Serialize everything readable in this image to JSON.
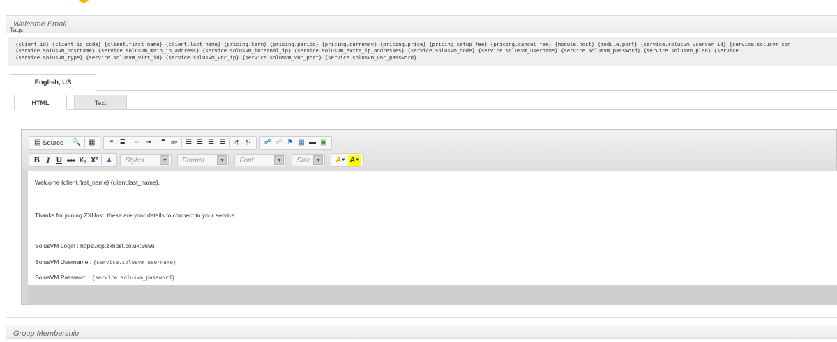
{
  "welcome_email": {
    "header": "Welcome Email",
    "tags_label": "Tags:",
    "tags_lines": [
      "{client.id} {client.id_code} {client.first_name} {client.last_name} {pricing.term} {pricing.period} {pricing.currency} {pricing.price} {pricing.setup_fee} {pricing.cancel_fee} {module.host} {module.port} {service.solusvm_vserver_id} {service.solusvm_con",
      "{service.solusvm_hostname} {service.solusvm_main_ip_address} {service.solusvm_internal_ip} {service.solusvm_extra_ip_addresses} {service.solusvm_node} {service.solusvm_username} {service.solusvm_password} {service.solusvm_plan} {service.",
      "{service.solusvm_type} {service.solusvm_virt_id} {service.solusvm_vnc_ip} {service.solusvm_vnc_port} {service.solusvm_vnc_password}"
    ],
    "language_tab": "English, US",
    "mode_tabs": {
      "html": "HTML",
      "text": "Text"
    }
  },
  "toolbar": {
    "source_label": "Source",
    "bold": "B",
    "italic": "I",
    "underline": "U",
    "strike": "abc",
    "subscript": "X₂",
    "superscript": "X²",
    "styles_placeholder": "Styles",
    "format_placeholder": "Format",
    "font_placeholder": "Font",
    "size_placeholder": "Size",
    "text_color": "A",
    "bg_color": "A",
    "icons": {
      "source": "source-doc-icon",
      "preview": "preview-icon",
      "templates": "templates-icon",
      "numbered_list": "numbered-list-icon",
      "bulleted_list": "bulleted-list-icon",
      "outdent": "outdent-icon",
      "indent": "indent-icon",
      "blockquote": "blockquote-icon",
      "div": "create-div-icon",
      "align_left": "align-left-icon",
      "align_center": "align-center-icon",
      "align_right": "align-right-icon",
      "justify": "justify-icon",
      "ltr": "ltr-icon",
      "rtl": "rtl-icon",
      "link": "link-icon",
      "unlink": "unlink-icon",
      "anchor": "anchor-flag-icon",
      "table": "table-icon",
      "hr": "horizontal-rule-icon",
      "image": "image-icon",
      "remove_format": "eraser-icon"
    }
  },
  "editor": {
    "line1": "Welcome {client.first_name} {client.last_name},",
    "line2": "Thanks for joining ZXHost, these are your details to connect to your service.",
    "login_label": "SolusVM Login : https://cp.zxhost.co.uk:5656",
    "username_label": "SolusVM Username : ",
    "username_tag": "{service.solusvm_username}",
    "password_label": "SolusVM Password : ",
    "password_tag": "{service.solusvm_password}"
  },
  "group_membership": {
    "header": "Group Membership"
  },
  "colors": {
    "panel_header_bg": "#ececec",
    "tags_bg": "#efefef",
    "editor_chrome": "#d7d7d7",
    "text_color_swatch": "#e8a000",
    "bg_color_swatch": "#ffff00"
  }
}
